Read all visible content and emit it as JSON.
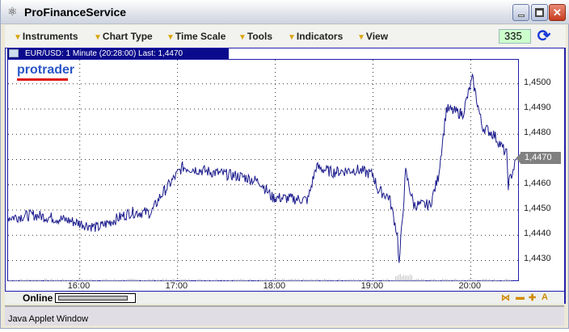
{
  "window": {
    "title": "ProFinanceService"
  },
  "toolbar": {
    "menus": [
      "Instruments",
      "Chart Type",
      "Time Scale",
      "Tools",
      "Indicators",
      "View"
    ],
    "counter": "335"
  },
  "chart": {
    "header": "EUR/USD: 1 Minute (20:28:00) Last: 1,4470",
    "logo": "protrader",
    "last_label": "1,4470",
    "line_color": "#1a1a8c"
  },
  "chart_data": {
    "type": "line",
    "title": "EUR/USD: 1 Minute",
    "x_ticks": [
      "16:00",
      "17:00",
      "18:00",
      "19:00",
      "20:00"
    ],
    "y_ticks": [
      "1,4500",
      "1,4490",
      "1,4480",
      "1,4470",
      "1,4460",
      "1,4450",
      "1,4440",
      "1,4430"
    ],
    "ylim": [
      1.44215,
      1.45095
    ],
    "xlim_minutes_from_1600": [
      -44,
      270
    ],
    "series": [
      {
        "name": "EUR/USD",
        "points": [
          [
            "15:16",
            1.4447
          ],
          [
            "15:32",
            1.4448
          ],
          [
            "15:52",
            1.4446
          ],
          [
            "16:11",
            1.4443
          ],
          [
            "16:31",
            1.4449
          ],
          [
            "16:44",
            1.4449
          ],
          [
            "16:49",
            1.4455
          ],
          [
            "16:56",
            1.4461
          ],
          [
            "17:03",
            1.4467
          ],
          [
            "17:21",
            1.4465
          ],
          [
            "17:41",
            1.4463
          ],
          [
            "17:51",
            1.4461
          ],
          [
            "17:58",
            1.4455
          ],
          [
            "18:20",
            1.4454
          ],
          [
            "18:25",
            1.4467
          ],
          [
            "18:35",
            1.4465
          ],
          [
            "18:50",
            1.4466
          ],
          [
            "19:00",
            1.4464
          ],
          [
            "19:03",
            1.4458
          ],
          [
            "19:10",
            1.4455
          ],
          [
            "19:15",
            1.444
          ],
          [
            "19:16",
            1.4428
          ],
          [
            "19:20",
            1.4465
          ],
          [
            "19:25",
            1.4452
          ],
          [
            "19:35",
            1.4452
          ],
          [
            "19:40",
            1.4463
          ],
          [
            "19:45",
            1.449
          ],
          [
            "19:55",
            1.4488
          ],
          [
            "20:01",
            1.4502
          ],
          [
            "20:07",
            1.4483
          ],
          [
            "20:14",
            1.448
          ],
          [
            "20:22",
            1.4472
          ],
          [
            "20:23",
            1.446
          ],
          [
            "20:28",
            1.447
          ]
        ]
      }
    ],
    "last": 1.447,
    "grid": true
  },
  "status": {
    "online": "Online",
    "progress": 0.0
  },
  "applet": {
    "label": "Java Applet Window"
  }
}
